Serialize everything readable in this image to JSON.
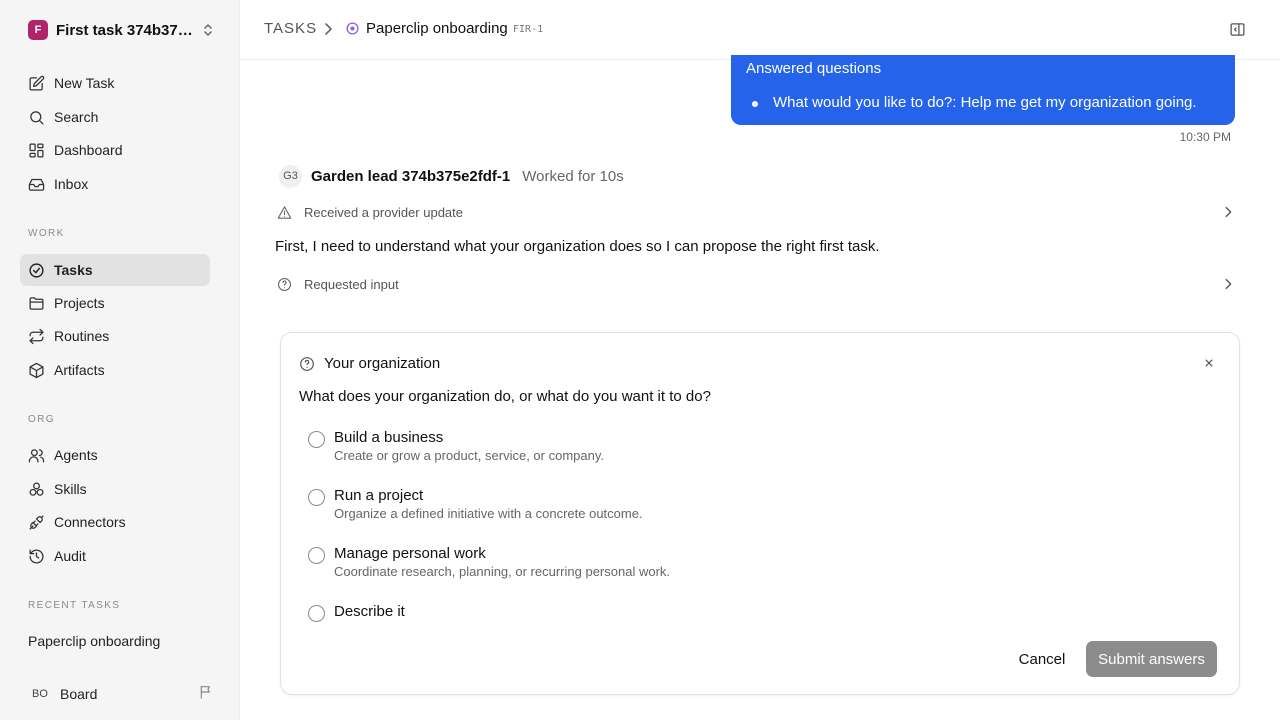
{
  "workspace": {
    "initial": "F",
    "name": "First task 374b375e2fdf-1",
    "logo_color": "#b0246b"
  },
  "nav": {
    "main": [
      {
        "label": "New Task",
        "icon": "edit-icon"
      },
      {
        "label": "Search",
        "icon": "search-icon"
      },
      {
        "label": "Dashboard",
        "icon": "dashboard-icon"
      },
      {
        "label": "Inbox",
        "icon": "inbox-icon"
      }
    ],
    "work_label": "WORK",
    "work": [
      {
        "label": "Tasks",
        "icon": "check-circle-icon",
        "active": true
      },
      {
        "label": "Projects",
        "icon": "folder-icon"
      },
      {
        "label": "Routines",
        "icon": "repeat-icon"
      },
      {
        "label": "Artifacts",
        "icon": "box-icon"
      }
    ],
    "org_label": "ORG",
    "org": [
      {
        "label": "Agents",
        "icon": "users-icon"
      },
      {
        "label": "Skills",
        "icon": "skills-icon"
      },
      {
        "label": "Connectors",
        "icon": "plug-icon"
      },
      {
        "label": "Audit",
        "icon": "history-icon"
      }
    ],
    "recent_label": "RECENT TASKS",
    "recent": [
      "Paperclip onboarding"
    ]
  },
  "user": {
    "initials": "BO",
    "name": "Board"
  },
  "header": {
    "root": "TASKS",
    "title": "Paperclip onboarding",
    "id": "FIR-1",
    "status_color": "#8b5cf6"
  },
  "thread": {
    "answered": {
      "title": "Answered questions",
      "items": [
        "What would you like to do?: Help me get my organization going."
      ],
      "color": "#2563eb"
    },
    "time": "10:30 PM",
    "agent": {
      "initials": "G3",
      "name": "Garden lead 374b375e2fdf-1",
      "meta": "Worked for 10s"
    },
    "event_update": "Received a provider update",
    "message": "First, I need to understand what your organization does so I can propose the right first task.",
    "event_input": "Requested input"
  },
  "question": {
    "title": "Your organization",
    "prompt": "What does your organization do, or what do you want it to do?",
    "options": [
      {
        "title": "Build a business",
        "desc": "Create or grow a product, service, or company."
      },
      {
        "title": "Run a project",
        "desc": "Organize a defined initiative with a concrete outcome."
      },
      {
        "title": "Manage personal work",
        "desc": "Coordinate research, planning, or recurring personal work."
      },
      {
        "title": "Describe it",
        "desc": ""
      }
    ],
    "cancel_label": "Cancel",
    "submit_label": "Submit answers"
  }
}
